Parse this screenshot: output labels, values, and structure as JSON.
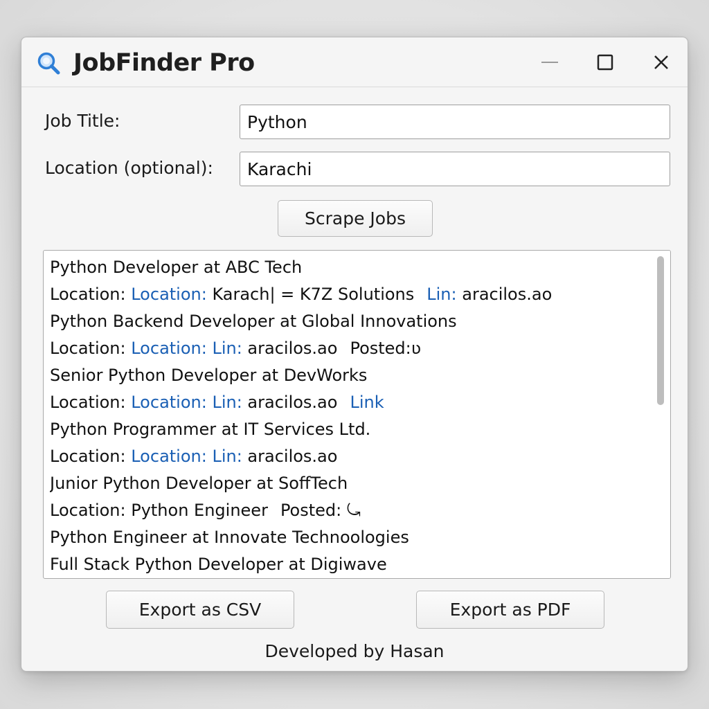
{
  "window": {
    "title": "JobFinder Pro",
    "icon": "search-icon",
    "controls": [
      "minimize-icon",
      "maximize-icon",
      "close-icon"
    ]
  },
  "form": {
    "job_title_label": "Job Title:",
    "job_title_value": "Python",
    "location_label": "Location (optional):",
    "location_value": "Karachi",
    "scrape_label": "Scrape Jobs"
  },
  "results": {
    "lines": [
      {
        "parts": [
          {
            "text": "Python Developer at ABC Tech"
          }
        ]
      },
      {
        "parts": [
          {
            "text": "Location: "
          },
          {
            "text": "Location:",
            "color": "blue"
          },
          {
            "text": " Karach| = K7Z Solutions",
            "gap": true
          },
          {
            "text": "Lin:",
            "color": "blue"
          },
          {
            "text": " aracilos.ao"
          }
        ]
      },
      {
        "parts": [
          {
            "text": "Python Backend Developer at Global Innovations"
          }
        ]
      },
      {
        "parts": [
          {
            "text": "Location: "
          },
          {
            "text": "Location: Lin:",
            "color": "blue"
          },
          {
            "text": " aracilos.ao",
            "gap": true
          },
          {
            "text": "Posted:ʋ"
          }
        ]
      },
      {
        "parts": [
          {
            "text": "Senior Python Developer at DevWorks"
          }
        ]
      },
      {
        "parts": [
          {
            "text": "Location: "
          },
          {
            "text": "Location: Lin:",
            "color": "blue"
          },
          {
            "text": " aracilos.ao",
            "gap": true
          },
          {
            "text": "Link",
            "color": "blue"
          }
        ]
      },
      {
        "parts": [
          {
            "text": "Python Programmer at IT Services Ltd."
          }
        ]
      },
      {
        "parts": [
          {
            "text": "Location: "
          },
          {
            "text": "Location: Lin:",
            "color": "blue"
          },
          {
            "text": " aracilos.ao"
          }
        ]
      },
      {
        "parts": [
          {
            "text": "Junior Python Developer at SoffTech"
          }
        ]
      },
      {
        "parts": [
          {
            "text": "Location: Python Engineer",
            "gap": true
          },
          {
            "text": "Posted: ⤿"
          }
        ]
      },
      {
        "parts": [
          {
            "text": "Python Engineer at Innovate Technoologies"
          }
        ]
      },
      {
        "parts": [
          {
            "text": "Full Stack Python Developer at Digiwave"
          }
        ]
      }
    ],
    "scroll_fraction_visible": 0.47
  },
  "actions": {
    "export_csv_label": "Export as CSV",
    "export_pdf_label": "Export as PDF"
  },
  "footer": {
    "text": "Developed by Hasan"
  },
  "colors": {
    "link_blue": "#1a5fb4",
    "icon_blue": "#2f7fd6",
    "window_bg": "#f5f5f5"
  }
}
